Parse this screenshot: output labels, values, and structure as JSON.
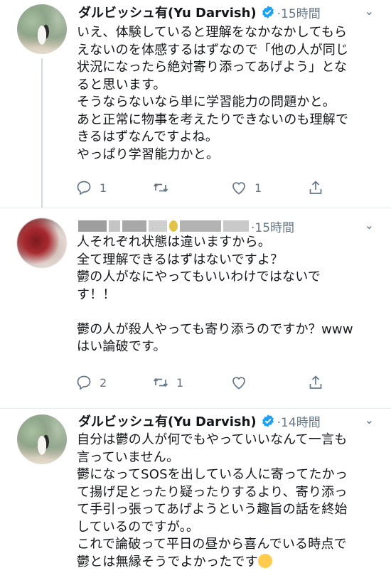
{
  "tweets": [
    {
      "author": "ダルビッシュ有(Yu Darvish)",
      "time": "·15時間",
      "text": "いえ、体験していると理解をなかなかしてもら\nえないのを体感するはずなので「他の人が同じ\n状況になったら絶対寄り添ってあげよう」とな\nると思います。\nそうならないなら単に学習能力の問題かと。\nあと正常に物事を考えたりできないのも理解で\nきるはずなんですよね。\nやっぱり学習能力かと。",
      "reply_count": "1",
      "retweet_count": "",
      "like_count": "1"
    },
    {
      "author": "",
      "time": "·15時間",
      "text": "人それぞれ状態は違いますから。\n全て理解できるはずはないですよ？\n鬱の人がなにやってもいいわけではないで\nす！！\n\n鬱の人が殺人やっても寄り添うのですか？www\nはい論破です。",
      "reply_count": "2",
      "retweet_count": "1",
      "like_count": ""
    },
    {
      "author": "ダルビッシュ有(Yu Darvish)",
      "time": "·14時間",
      "text": "自分は鬱の人が何でもやっていいなんて一言も\n言っていません。\n鬱になってSOSを出している人に寄ってたかっ\nて揚げ足とったり疑ったりするより、寄り添っ\nて手引っ張ってあげようという趣旨の話を終始\nしているのですが。。\nこれで論破って平日の昼から喜んでいる時点で\n鬱とは無縁そうでよかったです"
    }
  ],
  "icons": {
    "reply": "reply-icon",
    "retweet": "retweet-icon",
    "like": "heart-icon",
    "share": "share-icon",
    "verified": "verified-badge-icon",
    "caret": "chevron-down-icon"
  },
  "colors": {
    "verified": "#1da1f2",
    "muted": "#657786",
    "divider": "#e6ecf0"
  }
}
